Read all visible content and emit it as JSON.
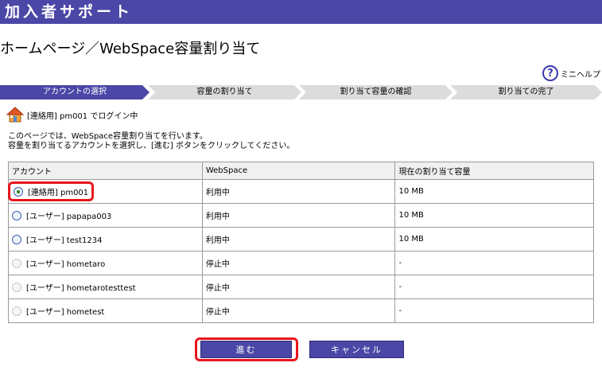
{
  "header": {
    "title": "加入者サポート"
  },
  "page": {
    "title": "ホームページ／WebSpace容量割り当て"
  },
  "help": {
    "label": "ミニヘルプ"
  },
  "steps": [
    {
      "label": "アカウントの選択",
      "active": true
    },
    {
      "label": "容量の割り当て",
      "active": false
    },
    {
      "label": "割り当て容量の確認",
      "active": false
    },
    {
      "label": "割り当ての完了",
      "active": false
    }
  ],
  "login": {
    "status": "[連絡用] pm001 でログイン中"
  },
  "intro": {
    "line1": "このページでは、WebSpace容量割り当てを行います。",
    "line2": "容量を割り当てるアカウントを選択し、[進む] ボタンをクリックしてください。"
  },
  "table": {
    "headers": [
      "アカウント",
      "WebSpace",
      "現在の割り当て容量"
    ],
    "rows": [
      {
        "account": "[連絡用] pm001",
        "webspace": "利用中",
        "capacity": "10 MB"
      },
      {
        "account": "[ユーザー] papapa003",
        "webspace": "利用中",
        "capacity": "10 MB"
      },
      {
        "account": "[ユーザー] test1234",
        "webspace": "利用中",
        "capacity": "10 MB"
      },
      {
        "account": "[ユーザー] hometaro",
        "webspace": "停止中",
        "capacity": "-"
      },
      {
        "account": "[ユーザー] hometarotesttest",
        "webspace": "停止中",
        "capacity": "-"
      },
      {
        "account": "[ユーザー] hometest",
        "webspace": "停止中",
        "capacity": "-"
      }
    ]
  },
  "buttons": {
    "next": "進む",
    "cancel": "キャンセル"
  },
  "colors": {
    "brand": "#4b47a6",
    "highlight": "#e8151c",
    "step_inactive": "#dcdcdc"
  }
}
